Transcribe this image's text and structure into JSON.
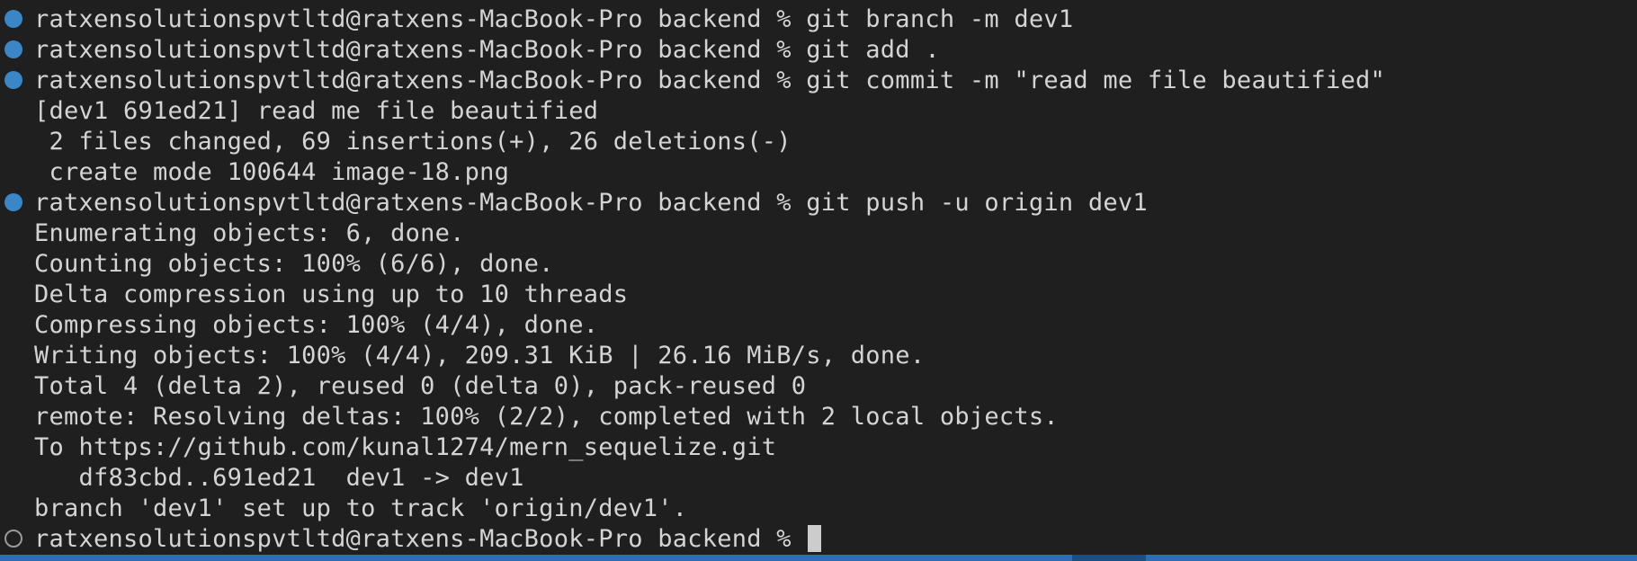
{
  "terminal": {
    "lines": [
      {
        "marker": "done",
        "text": "ratxensolutionspvtltd@ratxens-MacBook-Pro backend % git branch -m dev1"
      },
      {
        "marker": "done",
        "text": "ratxensolutionspvtltd@ratxens-MacBook-Pro backend % git add ."
      },
      {
        "marker": "done",
        "text": "ratxensolutionspvtltd@ratxens-MacBook-Pro backend % git commit -m \"read me file beautified\""
      },
      {
        "marker": "none",
        "text": "[dev1 691ed21] read me file beautified"
      },
      {
        "marker": "none",
        "text": " 2 files changed, 69 insertions(+), 26 deletions(-)"
      },
      {
        "marker": "none",
        "text": " create mode 100644 image-18.png"
      },
      {
        "marker": "done",
        "text": "ratxensolutionspvtltd@ratxens-MacBook-Pro backend % git push -u origin dev1"
      },
      {
        "marker": "none",
        "text": "Enumerating objects: 6, done."
      },
      {
        "marker": "none",
        "text": "Counting objects: 100% (6/6), done."
      },
      {
        "marker": "none",
        "text": "Delta compression using up to 10 threads"
      },
      {
        "marker": "none",
        "text": "Compressing objects: 100% (4/4), done."
      },
      {
        "marker": "none",
        "text": "Writing objects: 100% (4/4), 209.31 KiB | 26.16 MiB/s, done."
      },
      {
        "marker": "none",
        "text": "Total 4 (delta 2), reused 0 (delta 0), pack-reused 0"
      },
      {
        "marker": "none",
        "text": "remote: Resolving deltas: 100% (2/2), completed with 2 local objects."
      },
      {
        "marker": "none",
        "text": "To https://github.com/kunal1274/mern_sequelize.git"
      },
      {
        "marker": "none",
        "text": "   df83cbd..691ed21  dev1 -> dev1"
      },
      {
        "marker": "none",
        "text": "branch 'dev1' set up to track 'origin/dev1'."
      },
      {
        "marker": "pending",
        "text": "ratxensolutionspvtltd@ratxens-MacBook-Pro backend % "
      }
    ]
  },
  "colors": {
    "background": "#1f1f1f",
    "text": "#d4d4d4",
    "marker_done": "#3b86c6",
    "marker_pending": "#9a9a9a",
    "status_bar": "#2d6fb4"
  },
  "icons": {
    "marker_done": "filled-circle-decoration-icon",
    "marker_pending": "hollow-circle-decoration-icon"
  }
}
